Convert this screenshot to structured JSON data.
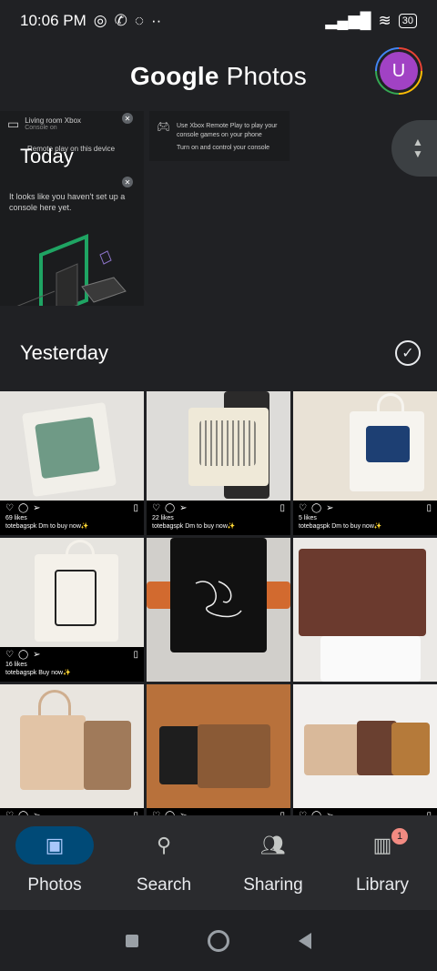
{
  "status_bar": {
    "time": "10:06 PM",
    "battery": "30"
  },
  "app_bar": {
    "title_part1": "Google",
    "title_part2": "Photos",
    "avatar_letter": "U"
  },
  "today": {
    "label": "Today",
    "console_card": {
      "line1": "Living room Xbox",
      "line2": "Console on",
      "line3": "Remote play on this device",
      "message": "It looks like you haven't set up a console here yet."
    },
    "card2": {
      "text": "Use Xbox Remote Play to play your console games on your phone",
      "text2": "Turn on and control your console"
    }
  },
  "section": {
    "label": "Yesterday"
  },
  "posts": [
    {
      "likes": "69 likes",
      "caption": "totebagspk Dm to buy now✨"
    },
    {
      "likes": "22 likes",
      "caption": "totebagspk Dm to buy now✨"
    },
    {
      "likes": "5 likes",
      "caption": "totebagspk Dm to buy now✨"
    },
    {
      "likes": "16 likes",
      "caption": "totebagspk Buy now✨"
    }
  ],
  "bottom_nav": [
    {
      "label": "Photos",
      "icon": "photo-icon"
    },
    {
      "label": "Search",
      "icon": "search-icon"
    },
    {
      "label": "Sharing",
      "icon": "people-icon"
    },
    {
      "label": "Library",
      "icon": "library-icon",
      "badge": "1"
    }
  ],
  "colors": {
    "accent": "#a8c7fa",
    "avatar": "#a142c4"
  }
}
